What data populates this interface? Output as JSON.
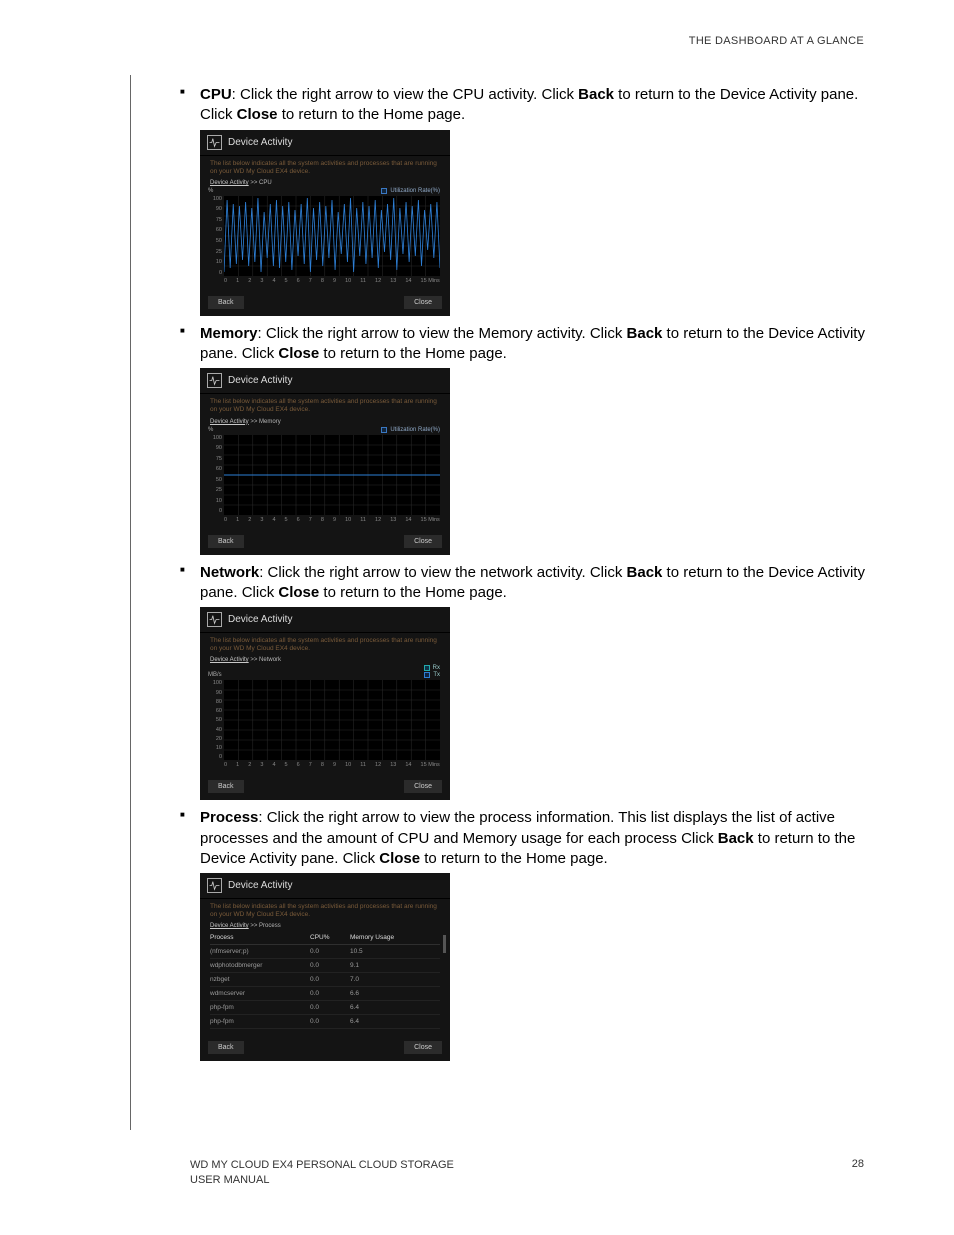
{
  "header": {
    "title": "THE DASHBOARD AT A GLANCE"
  },
  "items": {
    "cpu": {
      "label": "CPU",
      "text_a": ": Click the right arrow to view the CPU activity. Click ",
      "back": "Back",
      "text_b": " to return to the Device Activity pane. Click ",
      "close": "Close",
      "text_c": " to return to the Home page."
    },
    "memory": {
      "label": "Memory",
      "text_a": ": Click the right arrow to view the Memory activity. Click ",
      "back": "Back",
      "text_b": " to return to the Device Activity pane. Click ",
      "close": "Close",
      "text_c": " to return to the Home page."
    },
    "network": {
      "label": "Network",
      "text_a": ": Click the right arrow to view the network activity. Click ",
      "back": "Back",
      "text_b": " to return to the Device Activity pane. Click ",
      "close": "Close",
      "text_c": " to return to the Home page."
    },
    "process": {
      "label": "Process",
      "text_a": ": Click the right arrow to view the process information. This list displays the list of active processes and the amount of CPU and Memory usage for each process Click ",
      "back": "Back",
      "text_b": " to return to the Device Activity pane. Click ",
      "close": "Close",
      "text_c": " to return to the Home page."
    }
  },
  "panel": {
    "title": "Device Activity",
    "desc": "The list below indicates all the system activities and processes that are running on your WD My Cloud EX4 device.",
    "bc_root": "Device Activity",
    "bc_cpu": "CPU",
    "bc_mem": "Memory",
    "bc_net": "Network",
    "bc_proc": "Process",
    "sep": " >> ",
    "legend_util": "Utilization Rate(%)",
    "legend_rx": "Rx",
    "legend_tx": "Tx",
    "ylabel_pct": "%",
    "ylabel_mbs": "MB/s",
    "back_btn": "Back",
    "close_btn": "Close",
    "yticks_pct": [
      "100",
      "90",
      "75",
      "60",
      "50",
      "25",
      "10",
      "0"
    ],
    "yticks_mbs": [
      "100",
      "90",
      "80",
      "60",
      "50",
      "40",
      "20",
      "10",
      "0"
    ],
    "xticks": [
      "0",
      "1",
      "2",
      "3",
      "4",
      "5",
      "6",
      "7",
      "8",
      "9",
      "10",
      "11",
      "12",
      "13",
      "14"
    ],
    "xmins": "15 Mins",
    "proc_headers": {
      "c1": "Process",
      "c2": "CPU%",
      "c3": "Memory Usage"
    },
    "proc_rows": [
      {
        "c1": "(nfmserver;p)",
        "c2": "0.0",
        "c3": "10.5"
      },
      {
        "c1": "wdphotodbmerger",
        "c2": "0.0",
        "c3": "9.1"
      },
      {
        "c1": "nzbget",
        "c2": "0.0",
        "c3": "7.0"
      },
      {
        "c1": "wdmcserver",
        "c2": "0.0",
        "c3": "6.6"
      },
      {
        "c1": "php-fpm",
        "c2": "0.0",
        "c3": "6.4"
      },
      {
        "c1": "php-fpm",
        "c2": "0.0",
        "c3": "6.4"
      }
    ]
  },
  "chart_data": [
    {
      "type": "line",
      "title": "CPU Utilization",
      "xlabel": "Mins",
      "ylabel": "%",
      "ylim": [
        0,
        100
      ],
      "x": [
        0,
        1,
        2,
        3,
        4,
        5,
        6,
        7,
        8,
        9,
        10,
        11,
        12,
        13,
        14,
        15
      ],
      "series": [
        {
          "name": "Utilization Rate(%)",
          "values": [
            5,
            95,
            10,
            90,
            15,
            88,
            20,
            92,
            8,
            85,
            12,
            98,
            5,
            80,
            18,
            90
          ]
        }
      ]
    },
    {
      "type": "line",
      "title": "Memory Utilization",
      "xlabel": "Mins",
      "ylabel": "%",
      "ylim": [
        0,
        100
      ],
      "x": [
        0,
        1,
        2,
        3,
        4,
        5,
        6,
        7,
        8,
        9,
        10,
        11,
        12,
        13,
        14,
        15
      ],
      "series": [
        {
          "name": "Utilization Rate(%)",
          "values": [
            50,
            50,
            50,
            50,
            50,
            50,
            50,
            50,
            50,
            50,
            50,
            50,
            50,
            50,
            50,
            50
          ]
        }
      ]
    },
    {
      "type": "line",
      "title": "Network Activity",
      "xlabel": "Mins",
      "ylabel": "MB/s",
      "ylim": [
        0,
        100
      ],
      "x": [
        0,
        1,
        2,
        3,
        4,
        5,
        6,
        7,
        8,
        9,
        10,
        11,
        12,
        13,
        14,
        15
      ],
      "series": [
        {
          "name": "Rx",
          "values": [
            0,
            0,
            0,
            0,
            0,
            0,
            0,
            0,
            0,
            0,
            0,
            0,
            0,
            0,
            0,
            0
          ]
        },
        {
          "name": "Tx",
          "values": [
            0,
            0,
            0,
            0,
            0,
            0,
            0,
            0,
            0,
            0,
            0,
            0,
            0,
            0,
            0,
            0
          ]
        }
      ]
    },
    {
      "type": "table",
      "title": "Process",
      "columns": [
        "Process",
        "CPU%",
        "Memory Usage"
      ],
      "rows": [
        [
          "(nfmserver;p)",
          "0.0",
          "10.5"
        ],
        [
          "wdphotodbmerger",
          "0.0",
          "9.1"
        ],
        [
          "nzbget",
          "0.0",
          "7.0"
        ],
        [
          "wdmcserver",
          "0.0",
          "6.6"
        ],
        [
          "php-fpm",
          "0.0",
          "6.4"
        ],
        [
          "php-fpm",
          "0.0",
          "6.4"
        ]
      ]
    }
  ],
  "footer": {
    "product": "WD MY CLOUD EX4 PERSONAL CLOUD STORAGE",
    "manual": "USER MANUAL",
    "page": "28"
  }
}
